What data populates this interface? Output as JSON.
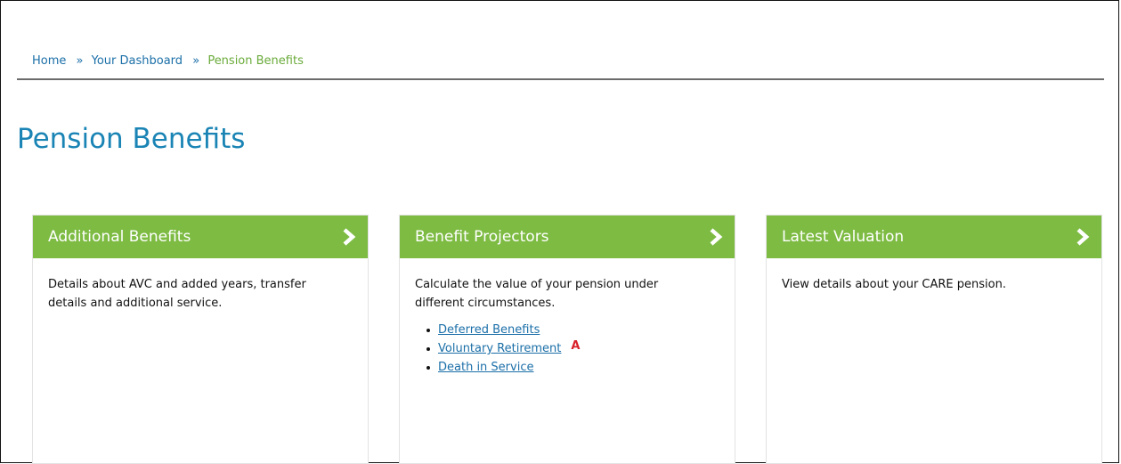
{
  "breadcrumb": {
    "home": "Home",
    "separator_1": "»",
    "dashboard": "Your Dashboard",
    "separator_2": "»",
    "current": "Pension Benefits"
  },
  "page": {
    "title": "Pension Benefits"
  },
  "cards": [
    {
      "title": "Additional Benefits",
      "description": "Details about AVC and added years, transfer details and additional service.",
      "icon": "chevron-right-icon"
    },
    {
      "title": "Benefit Projectors",
      "description": "Calculate the value of your pension under different circumstances.",
      "icon": "chevron-right-icon",
      "links": [
        {
          "label": "Deferred Benefits"
        },
        {
          "label": "Voluntary Retirement",
          "marker": "A"
        },
        {
          "label": "Death in Service"
        }
      ]
    },
    {
      "title": "Latest Valuation",
      "description": "View details about your CARE pension.",
      "icon": "chevron-right-icon"
    }
  ],
  "colors": {
    "header_green": "#7dbb42",
    "link_blue": "#1b6fa8",
    "title_blue": "#1a84b5",
    "breadcrumb_current": "#6aab3a",
    "marker_red": "#d8202a"
  }
}
